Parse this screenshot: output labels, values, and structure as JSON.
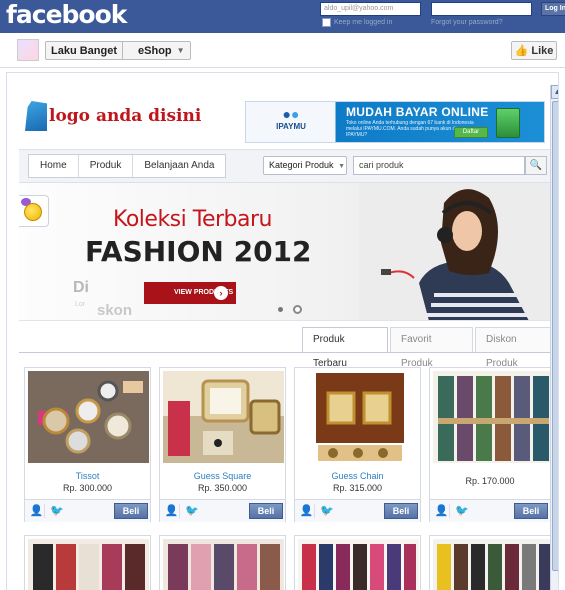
{
  "facebook": {
    "logo": "facebook",
    "email_value": "aldo_upil@yahoo.com",
    "keep_logged_in": "Keep me logged in",
    "forgot_password": "Forgot your password?",
    "login_label": "Log In",
    "brand_color": "#3b5998"
  },
  "app_bar": {
    "title": "Laku Banget",
    "section": "eShop",
    "like_label": "Like"
  },
  "store": {
    "logo_text": "logo anda disini",
    "ad": {
      "brand": "IPAYMU",
      "headline": "MUDAH BAYAR ONLINE",
      "subtext": "Toko online Anda terhubung dengan 67 bank di Indonesia melalui IPAYMU.COM. Anda sudah punya akun di IPAYMU?",
      "button": "Daftar"
    },
    "nav": [
      "Home",
      "Produk",
      "Belanjaan Anda"
    ],
    "category_select": "Kategori Produk",
    "search_placeholder": "cari produk",
    "banner": {
      "line1": "Koleksi Terbaru",
      "line2": "FASHION 2012",
      "button": "VIEW PRODUCTS",
      "faded1": "Di",
      "faded2": "skon",
      "faded3": "Lor"
    },
    "tabs": [
      "Produk Terbaru",
      "Favorit Produk",
      "Diskon Produk"
    ],
    "products": [
      {
        "name": "Tissot",
        "price": "Rp. 300.000",
        "buy": "Beli",
        "icon": "watch"
      },
      {
        "name": "Guess Square",
        "price": "Rp. 350.000",
        "buy": "Beli",
        "icon": "watch"
      },
      {
        "name": "Guess Chain",
        "price": "Rp. 315.000",
        "buy": "Beli",
        "icon": "watch"
      },
      {
        "name": "",
        "price": "Rp. 170.000",
        "buy": "Beli",
        "icon": "dress"
      }
    ]
  },
  "accent_red": "#c0151c",
  "link_blue": "#2d7fc1"
}
